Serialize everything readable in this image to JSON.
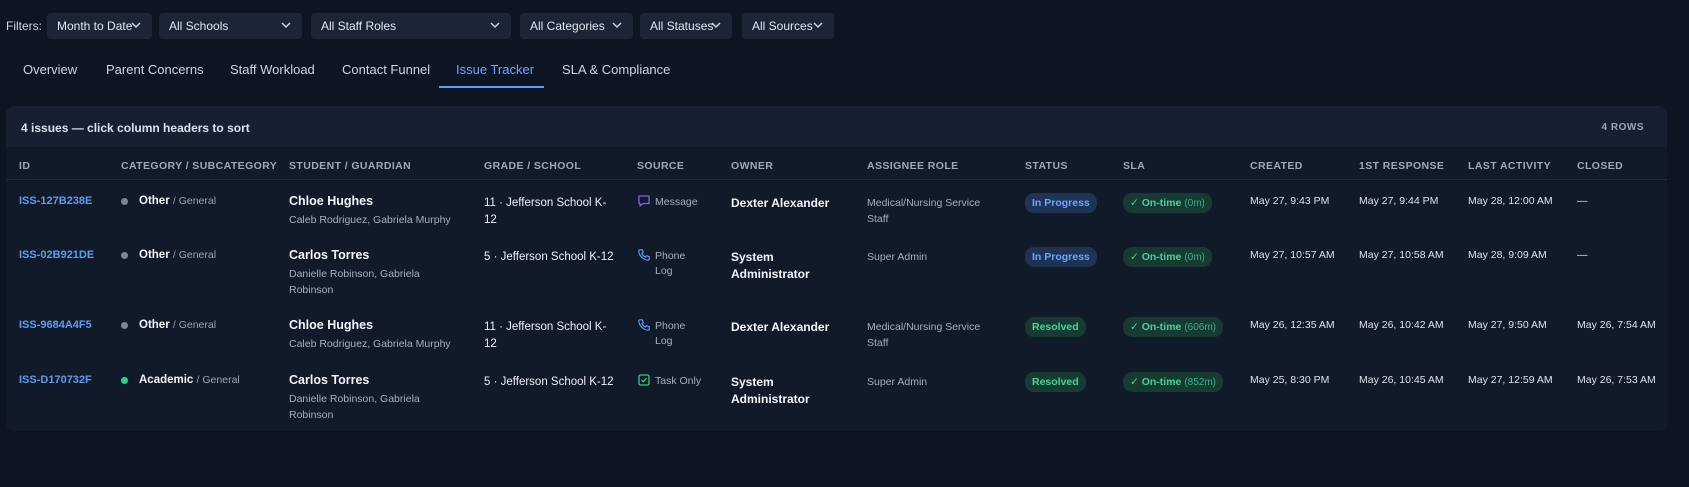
{
  "filters": {
    "label": "Filters:",
    "items": [
      {
        "name": "date-range-select",
        "value": "Month to Date"
      },
      {
        "name": "school-select",
        "value": "All Schools"
      },
      {
        "name": "staff-role-select",
        "value": "All Staff Roles"
      },
      {
        "name": "category-select",
        "value": "All Categories"
      },
      {
        "name": "status-select",
        "value": "All Statuses"
      },
      {
        "name": "source-select",
        "value": "All Sources"
      }
    ]
  },
  "tabs": [
    {
      "label": "Overview"
    },
    {
      "label": "Parent Concerns"
    },
    {
      "label": "Staff Workload"
    },
    {
      "label": "Contact Funnel"
    },
    {
      "label": "Issue Tracker",
      "active": true
    },
    {
      "label": "SLA & Compliance"
    }
  ],
  "panel": {
    "title": "4 issues — click column headers to sort",
    "rows_count": "4 ROWS"
  },
  "columns": [
    "ID",
    "CATEGORY / SUBCATEGORY",
    "STUDENT / GUARDIAN",
    "GRADE / SCHOOL",
    "SOURCE",
    "OWNER",
    "ASSIGNEE ROLE",
    "STATUS",
    "SLA",
    "CREATED",
    "1ST RESPONSE",
    "LAST ACTIVITY",
    "CLOSED"
  ],
  "colors": {
    "accent": "#5b9cf7",
    "other_dot": "#7a8596",
    "academic_dot": "#2fcf8a",
    "message_icon": "#8b5cf6",
    "phone_icon": "#5b9cf7",
    "task_icon": "#2fcf8a"
  },
  "rows": [
    {
      "id": "ISS-127B238E",
      "category": "Other",
      "subcategory": "/ General",
      "category_dot": "other",
      "student": "Chloe Hughes",
      "guardians": "Caleb Rodriguez, Gabriela Murphy",
      "grade_school": "11 · Jefferson School K-12",
      "source_icon": "message-icon",
      "source": "Message",
      "owner": "Dexter Alexander",
      "role": "Medical/Nursing Service Staff",
      "status": "In Progress",
      "sla": "✓ On-time",
      "sla_time": "(0m)",
      "created": "May 27, 9:43 PM",
      "first_response": "May 27, 9:44 PM",
      "last_activity": "May 28, 12:00 AM",
      "closed": "—"
    },
    {
      "id": "ISS-02B921DE",
      "category": "Other",
      "subcategory": "/ General",
      "category_dot": "other",
      "student": "Carlos Torres",
      "guardians": "Danielle Robinson, Gabriela Robinson",
      "grade_school": "5 · Jefferson School K-12",
      "source_icon": "phone-icon",
      "source": "Phone Log",
      "owner": "System Administrator",
      "role": "Super Admin",
      "status": "In Progress",
      "sla": "✓ On-time",
      "sla_time": "(0m)",
      "created": "May 27, 10:57 AM",
      "first_response": "May 27, 10:58 AM",
      "last_activity": "May 28, 9:09 AM",
      "closed": "—"
    },
    {
      "id": "ISS-9684A4F5",
      "category": "Other",
      "subcategory": "/ General",
      "category_dot": "other",
      "student": "Chloe Hughes",
      "guardians": "Caleb Rodriguez, Gabriela Murphy",
      "grade_school": "11 · Jefferson School K-12",
      "source_icon": "phone-icon",
      "source": "Phone Log",
      "owner": "Dexter Alexander",
      "role": "Medical/Nursing Service Staff",
      "status": "Resolved",
      "sla": "✓ On-time",
      "sla_time": "(606m)",
      "created": "May 26, 12:35 AM",
      "first_response": "May 26, 10:42 AM",
      "last_activity": "May 27, 9:50 AM",
      "closed": "May 26, 7:54 AM"
    },
    {
      "id": "ISS-D170732F",
      "category": "Academic",
      "subcategory": "/ General",
      "category_dot": "academic",
      "student": "Carlos Torres",
      "guardians": "Danielle Robinson, Gabriela Robinson",
      "grade_school": "5 · Jefferson School K-12",
      "source_icon": "task-icon",
      "source": "Task Only",
      "owner": "System Administrator",
      "role": "Super Admin",
      "status": "Resolved",
      "sla": "✓ On-time",
      "sla_time": "(852m)",
      "created": "May 25, 8:30 PM",
      "first_response": "May 26, 10:45 AM",
      "last_activity": "May 27, 12:59 AM",
      "closed": "May 26, 7:53 AM"
    }
  ]
}
